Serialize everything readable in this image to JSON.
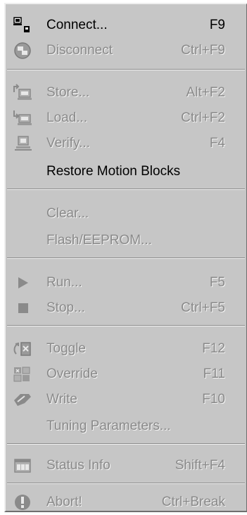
{
  "menu": {
    "items": [
      {
        "label": "Connect...",
        "shortcut": "F9",
        "icon": "connect-icon",
        "enabled": true
      },
      {
        "label": "Disconnect",
        "shortcut": "Ctrl+F9",
        "icon": "disconnect-icon",
        "enabled": false
      },
      {
        "label": "Store...",
        "shortcut": "Alt+F2",
        "icon": "store-icon",
        "enabled": false
      },
      {
        "label": "Load...",
        "shortcut": "Ctrl+F2",
        "icon": "load-icon",
        "enabled": false
      },
      {
        "label": "Verify...",
        "shortcut": "F4",
        "icon": "verify-icon",
        "enabled": false
      },
      {
        "label": "Restore Motion Blocks",
        "shortcut": "",
        "icon": "",
        "enabled": true
      },
      {
        "label": "Clear...",
        "shortcut": "",
        "icon": "",
        "enabled": false
      },
      {
        "label": "Flash/EEPROM...",
        "shortcut": "",
        "icon": "",
        "enabled": false
      },
      {
        "label": "Run...",
        "shortcut": "F5",
        "icon": "play-icon",
        "enabled": false
      },
      {
        "label": "Stop...",
        "shortcut": "Ctrl+F5",
        "icon": "stop-icon",
        "enabled": false
      },
      {
        "label": "Toggle",
        "shortcut": "F12",
        "icon": "toggle-icon",
        "enabled": false
      },
      {
        "label": "Override",
        "shortcut": "F11",
        "icon": "override-icon",
        "enabled": false
      },
      {
        "label": "Write",
        "shortcut": "F10",
        "icon": "write-icon",
        "enabled": false
      },
      {
        "label": "Tuning Parameters...",
        "shortcut": "",
        "icon": "",
        "enabled": false
      },
      {
        "label": "Status Info",
        "shortcut": "Shift+F4",
        "icon": "status-info-icon",
        "enabled": false
      },
      {
        "label": "Abort!",
        "shortcut": "Ctrl+Break",
        "icon": "abort-icon",
        "enabled": false
      }
    ]
  },
  "colors": {
    "menu_bg": "#c6c6c6",
    "text_enabled": "#000000",
    "text_disabled": "#8a8a8a"
  }
}
